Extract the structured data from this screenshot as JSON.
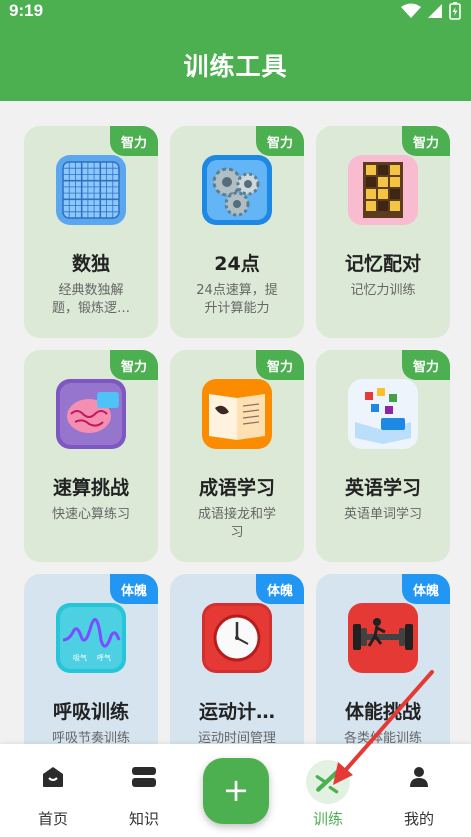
{
  "status": {
    "time": "9:19"
  },
  "header": {
    "title": "训练工具"
  },
  "cards": [
    {
      "tag": "智力",
      "title": "数独",
      "desc": "经典数独解题，锻炼逻…",
      "icon": "sudoku-icon",
      "category": "mind"
    },
    {
      "tag": "智力",
      "title": "24点",
      "desc": "24点速算，提升计算能力",
      "icon": "gears-icon",
      "category": "mind"
    },
    {
      "tag": "智力",
      "title": "记忆配对",
      "desc": "记忆力训练",
      "icon": "memory-grid-icon",
      "category": "mind"
    },
    {
      "tag": "智力",
      "title": "速算挑战",
      "desc": "快速心算练习",
      "icon": "brain-icon",
      "category": "mind"
    },
    {
      "tag": "智力",
      "title": "成语学习",
      "desc": "成语接龙和学习",
      "icon": "book-icon",
      "category": "mind"
    },
    {
      "tag": "智力",
      "title": "英语学习",
      "desc": "英语单词学习",
      "icon": "abc-book-icon",
      "category": "mind"
    },
    {
      "tag": "体魄",
      "title": "呼吸训练",
      "desc": "呼吸节奏训练",
      "icon": "breath-wave-icon",
      "category": "body",
      "icon_text": [
        "吸气",
        "呼气"
      ]
    },
    {
      "tag": "体魄",
      "title": "运动计…",
      "desc": "运动时间管理",
      "icon": "clock-icon",
      "category": "body"
    },
    {
      "tag": "体魄",
      "title": "体能挑战",
      "desc": "各类体能训练",
      "icon": "dumbbell-icon",
      "category": "body"
    }
  ],
  "nav": {
    "home": "首页",
    "knowledge": "知识",
    "add": "+",
    "training": "训练",
    "mine": "我的",
    "active": "training"
  },
  "colors": {
    "brand": "#4caf50",
    "mind_tag": "#4caf50",
    "body_tag": "#2196f3",
    "arrow": "#e53935"
  }
}
